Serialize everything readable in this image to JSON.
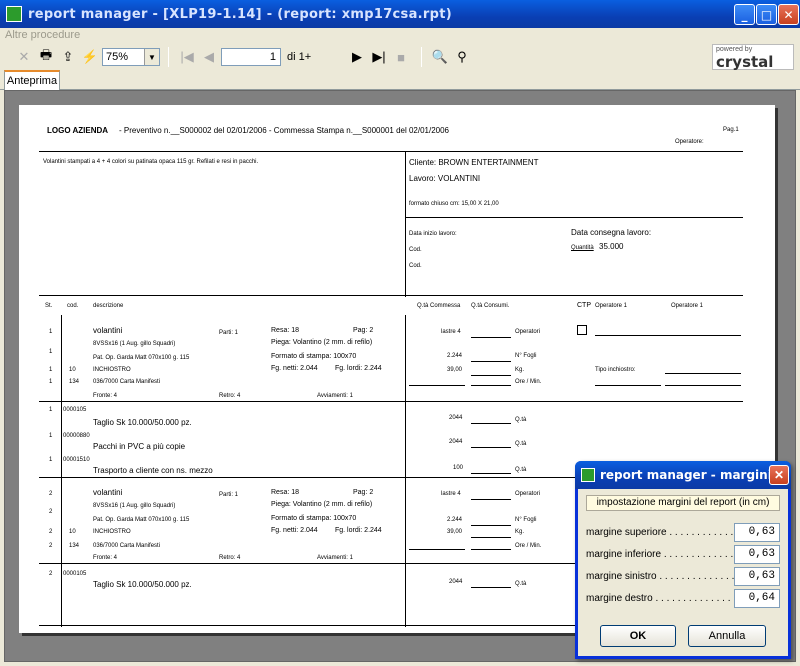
{
  "window": {
    "title": "report manager - [XLP19-1.14] - (report: xmp17csa.rpt)",
    "min": "_",
    "max": "□",
    "close": "✕"
  },
  "menu": {
    "label": "Altre procedure"
  },
  "toolbar": {
    "zoom": "75%",
    "page_value": "1",
    "page_of": "di 1+",
    "crystal_top": "powered by",
    "crystal_logo": "crystal"
  },
  "tab": {
    "label": "Anteprima"
  },
  "report": {
    "logo": "LOGO AZIENDA",
    "header": "- Preventivo n.__S000002 del 02/01/2006 - Commessa Stampa n.__S000001 del 02/01/2006",
    "pag": "Pag.1",
    "operatore": "Operatore:",
    "desc": "Volantini stampati a 4 + 4 colori su patinata opaca 115 gr. Refilati e resi in pacchi.",
    "cliente": "Cliente: BROWN ENTERTAINMENT",
    "lavoro": "Lavoro: VOLANTINI",
    "formato": "formato chiuso cm: 15,00 X 21,00",
    "data_inizio": "Data inizio lavoro:",
    "cod1": "Cod.",
    "cod2": "Cod.",
    "data_consegna": "Data consegna lavoro:",
    "esattamente_label": "Quantità",
    "esattamente_val": "35.000",
    "col_st": "St.",
    "col_cod": "cod.",
    "col_desc": "descrizione",
    "col_qcomm": "Q.tà Commessa",
    "col_qcons": "Q.tà Consumi.",
    "col_ctp": "CTP",
    "col_op1": "Operatore 1",
    "col_op2": "Operatore 1",
    "b1": {
      "n1": "1",
      "n2": "1",
      "n3": "1",
      "n4": "1",
      "n5": "1",
      "cod10": "10",
      "cod134": "134",
      "title": "volantini",
      "parti": "Parti: 1",
      "resa": "Resa: 18",
      "pag": "Pag: 2",
      "line2": "8VSSx16 (1 Aug. gillo Squadri)",
      "piega": "Piega: Volantino (2 mm. di refilo)",
      "line3": "Pat. Op. Garda Matt 070x100 g. 115",
      "formato": "Formato di stampa: 100x70",
      "line4": "INCHIOSTRO",
      "fgnetti": "Fg. netti: 2.044",
      "fglordi": "Fg. lordi: 2.244",
      "line5": "036/7000 Carta Manifesti",
      "fronte": "Fronte: 4",
      "retro": "Retro: 4",
      "avviamenti": "Avviamenti: 1",
      "lastre": "lastre 4",
      "operatori": "Operatori",
      "v2244": "2.244",
      "nfogli": "N° Fogli",
      "v39": "39,00",
      "kg": "Kg.",
      "oremin": "Ore / Min.",
      "tipo": "Tipo inchiostro:"
    },
    "b2": {
      "n1": "1",
      "n2": "1",
      "n3": "1",
      "c1": "0000105",
      "c2": "00000880",
      "c3": "00001510",
      "t1": "Taglio Sk 10.000/50.000 pz.",
      "t2": "Pacchi in PVC a più copie",
      "t3": "Trasporto a cliente con ns. mezzo",
      "q1": "2044",
      "q2": "2044",
      "q3": "100",
      "qt1": "Q.tà",
      "qt2": "Q.tà",
      "qt3": "Q.tà"
    },
    "b3": {
      "n1": "2",
      "n2": "2",
      "n3": "2",
      "n4": "2",
      "n5": "2",
      "cod10": "10",
      "cod134": "134",
      "title": "volantini",
      "parti": "Parti: 1",
      "resa": "Resa: 18",
      "pag": "Pag: 2",
      "line2": "8VSSx16 (1 Aug. gillo Squadri)",
      "piega": "Piega: Volantino (2 mm. di refilo)",
      "line3": "Pat. Op. Garda Matt 070x100 g. 115",
      "formato": "Formato di stampa: 100x70",
      "line4": "INCHIOSTRO",
      "fgnetti": "Fg. netti: 2.044",
      "fglordi": "Fg. lordi: 2.244",
      "line5": "036/7000 Carta Manifesti",
      "fronte": "Fronte: 4",
      "retro": "Retro: 4",
      "avviamenti": "Avviamenti: 1",
      "lastre": "lastre 4",
      "operatori": "Operatori",
      "v2244": "2.244",
      "nfogli": "N° Fogli",
      "v39": "39,00",
      "kg": "Kg.",
      "oremin": "Ore / Min."
    },
    "b4": {
      "n1": "2",
      "c1": "0000105",
      "t1": "Taglio Sk 10.000/50.000 pz.",
      "q1": "2044",
      "qt1": "Q.tà"
    }
  },
  "dialog": {
    "title": "report manager - margini",
    "close": "✕",
    "heading": "impostazione margini del report (in cm)",
    "rows": [
      {
        "label": "margine superiore . . . . . . . . . . . . . . . .",
        "value": "0,63"
      },
      {
        "label": "margine inferiore . . . . . . . . . . . . . . . .",
        "value": "0,63"
      },
      {
        "label": "margine sinistro . . . . . . . . . . . . . . . .",
        "value": "0,63"
      },
      {
        "label": "margine destro . . . . . . . . . . . . . . . .",
        "value": "0,64"
      }
    ],
    "ok": "OK",
    "cancel": "Annulla"
  }
}
